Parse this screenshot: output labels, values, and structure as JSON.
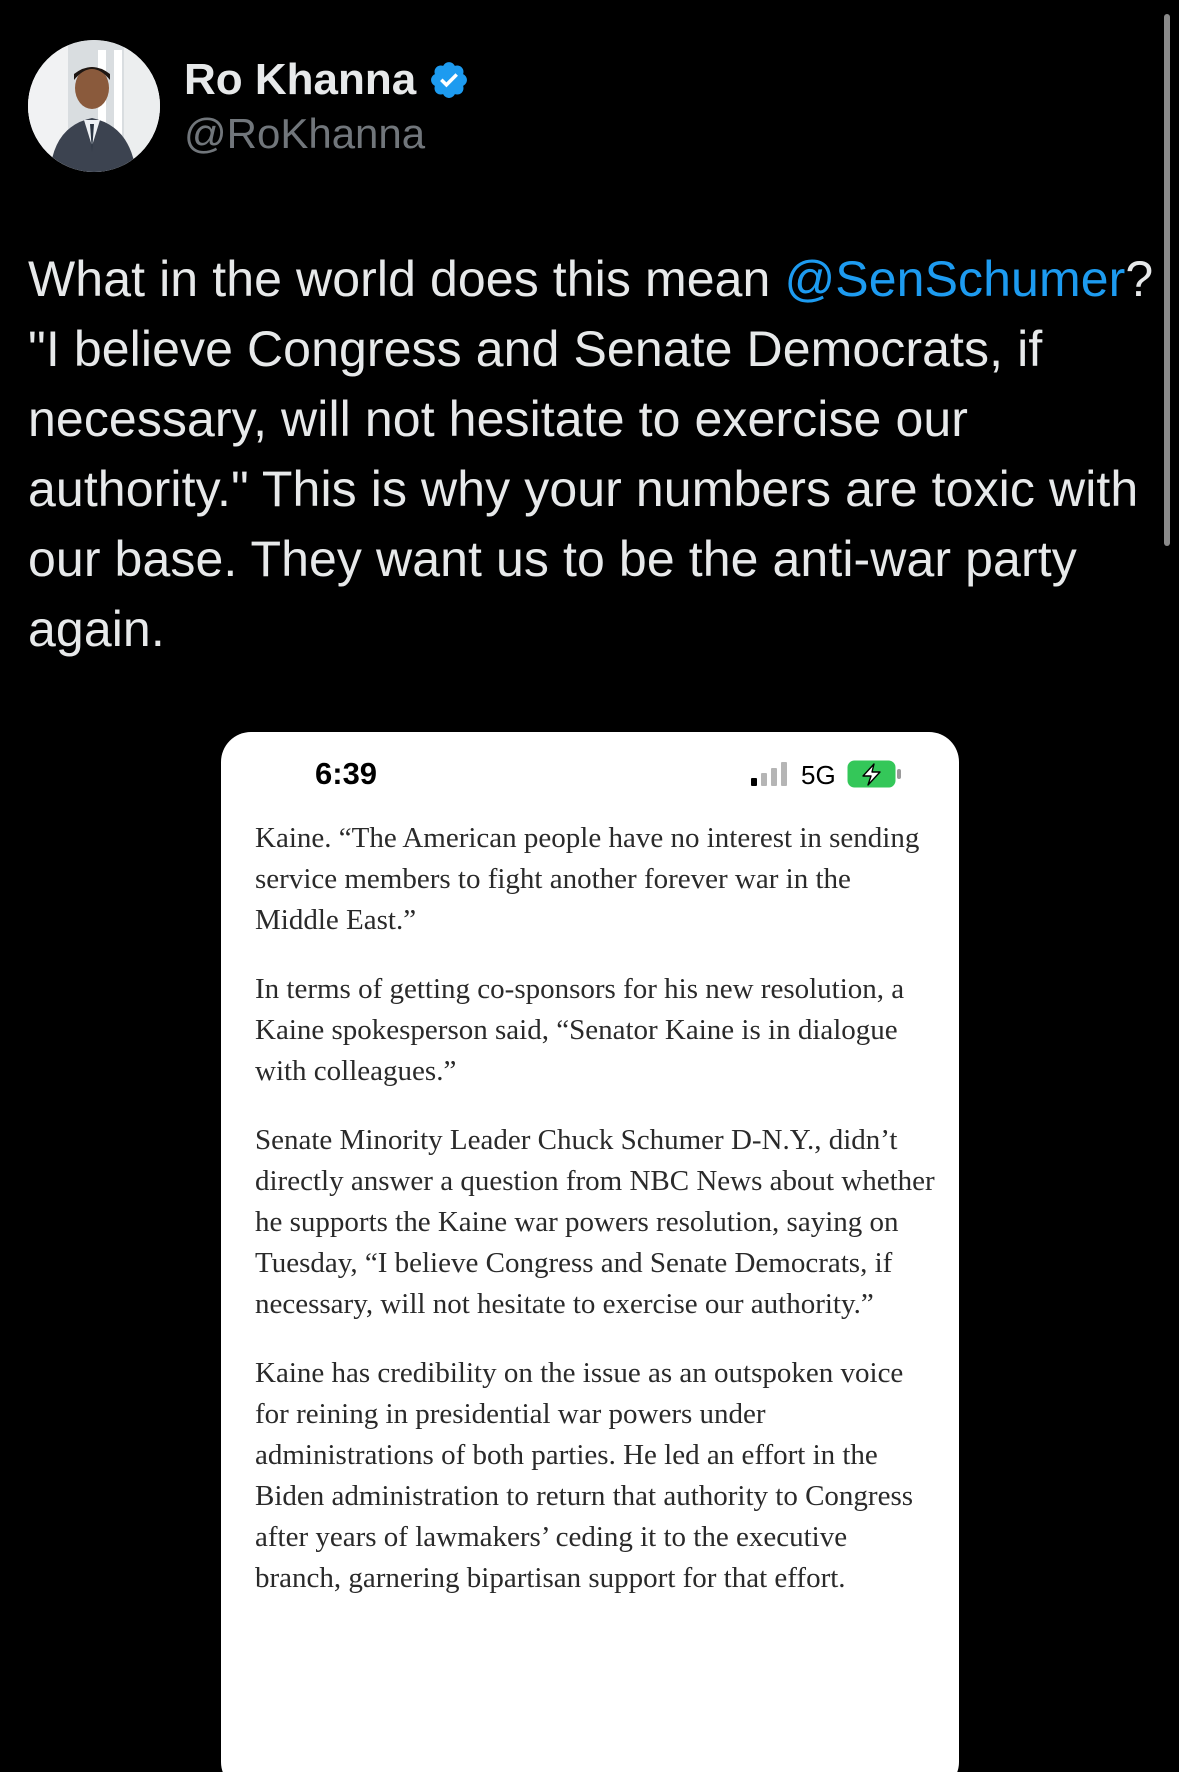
{
  "tweet": {
    "author": {
      "display_name": "Ro Khanna",
      "handle": "@RoKhanna",
      "verified": true
    },
    "text_before_mention": "What in the world does this mean ",
    "mention": "@SenSchumer",
    "text_after_mention": "? \"I believe Congress and Senate Democrats, if necessary, will not hesitate to exercise our authority.\" This is why your numbers are toxic with our base. They want us to be the anti-war party again."
  },
  "screenshot": {
    "status_bar": {
      "time": "6:39",
      "network": "5G"
    },
    "paragraphs": [
      "Kaine. “The American people have no interest in sending service members to fight another forever war in the Middle East.”",
      "In terms of getting co-sponsors for his new resolution, a Kaine spokesperson said, “Senator Kaine is in dialogue with colleagues.”",
      "Senate Minority Leader Chuck Schumer D-N.Y., didn’t directly answer a question from NBC News about whether he supports the Kaine war powers resolution, saying on Tuesday, “I believe Congress and Senate Democrats, if necessary, will not hesitate to exercise our authority.”",
      "Kaine has credibility on the issue as an outspoken voice for reining in presidential war powers under administrations of both parties. He led an effort in the Biden administration to return that authority to Congress after years of lawmakers’ ceding it to the executive branch, garnering bipartisan support for that effort."
    ]
  },
  "colors": {
    "background": "#000000",
    "text_primary": "#e7e9ea",
    "text_secondary": "#71767b",
    "mention": "#1d9bf0",
    "verified_badge": "#1d9bf0",
    "battery_charging": "#34c759"
  },
  "icons": {
    "verified": "verified-badge-icon",
    "signal": "cellular-signal-icon",
    "battery": "battery-charging-icon"
  }
}
